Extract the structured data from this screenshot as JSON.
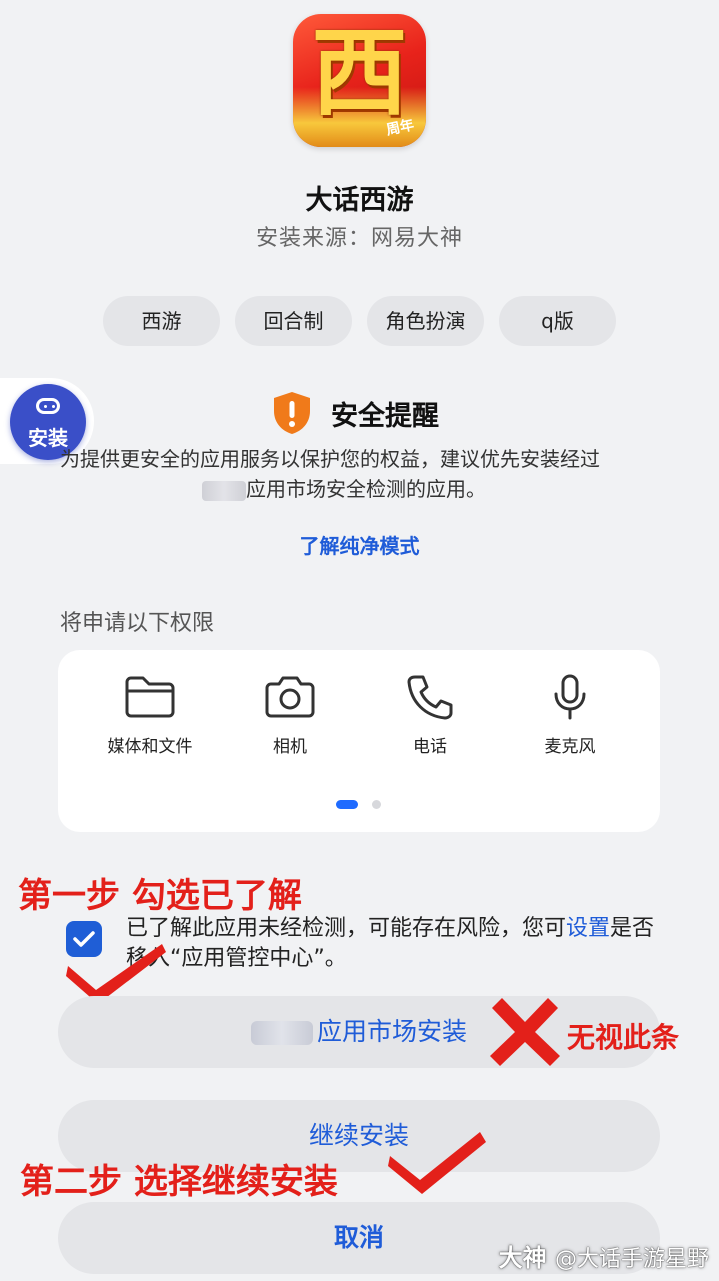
{
  "app": {
    "icon_glyph": "西",
    "icon_badge": "周年",
    "name": "大话西游",
    "source": "安装来源：网易大神"
  },
  "tags": [
    "西游",
    "回合制",
    "角色扮演",
    "q版"
  ],
  "floating_button": {
    "label": "安装"
  },
  "security": {
    "title": "安全提醒",
    "desc_line1": "为提供更安全的应用服务以保护您的权益，建议优先安装经过",
    "desc_line2": "应用市场安全检测的应用。",
    "link": "了解纯净模式"
  },
  "permissions": {
    "heading": "将申请以下权限",
    "items": [
      {
        "label": "媒体和文件",
        "icon": "folder-icon"
      },
      {
        "label": "相机",
        "icon": "camera-icon"
      },
      {
        "label": "电话",
        "icon": "phone-icon"
      },
      {
        "label": "麦克风",
        "icon": "microphone-icon"
      }
    ]
  },
  "consent": {
    "checked": true,
    "text_before": "已了解此应用未经检测，可能存在风险，您可",
    "link": "设置",
    "text_after": "是否移入“应用管控中心”。"
  },
  "buttons": {
    "market": "应用市场安装",
    "continue": "继续安装",
    "cancel": "取消"
  },
  "annotations": {
    "step1": "第一步 勾选已了解",
    "step2": "第二步 选择继续安装",
    "ignore": "无视此条"
  },
  "watermark": {
    "brand": "大神",
    "handle": "@大话手游星野"
  },
  "colors": {
    "accent": "#1f5cd8",
    "annotation": "#e3201a",
    "background": "#f1f2f4"
  }
}
